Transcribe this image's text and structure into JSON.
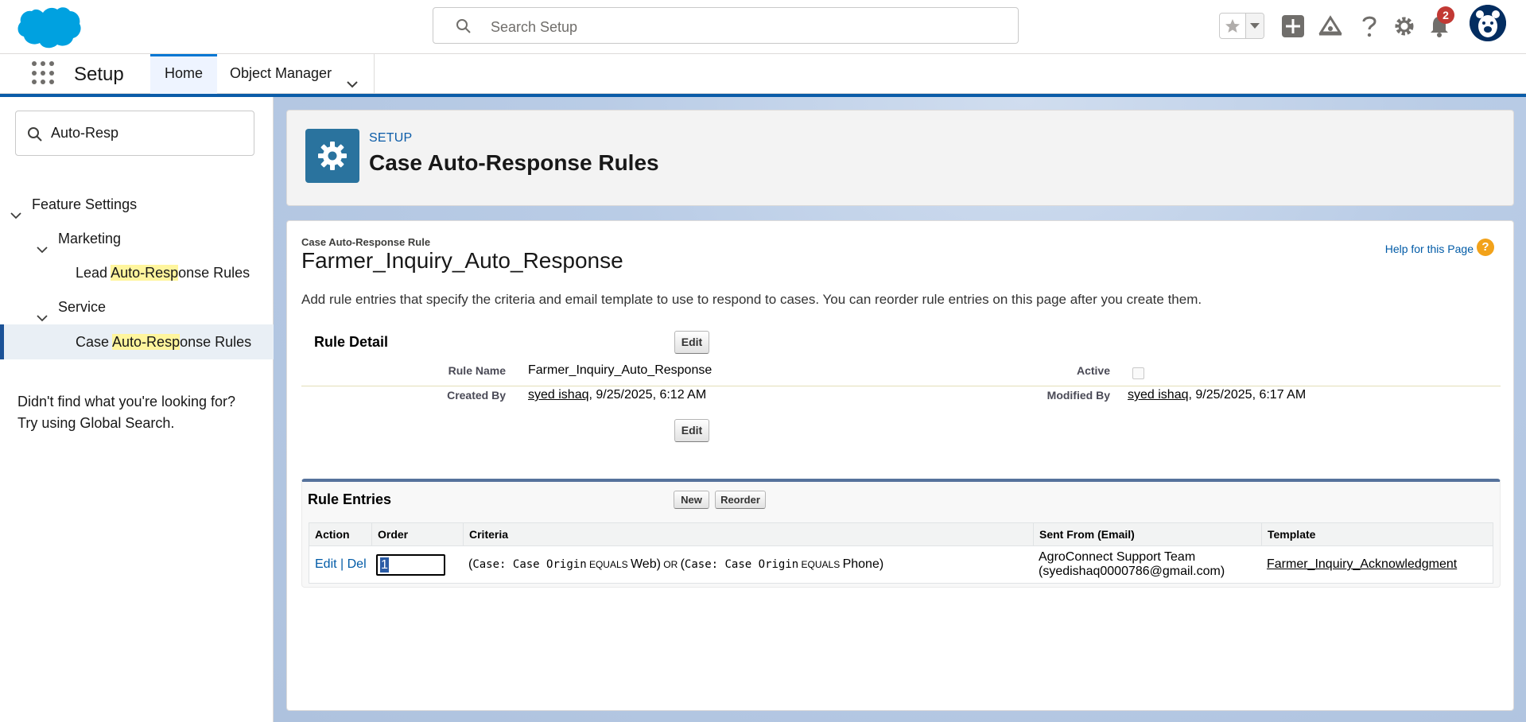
{
  "header": {
    "search_placeholder": "Search Setup",
    "notification_count": "2"
  },
  "nav": {
    "app_name": "Setup",
    "tabs": [
      {
        "label": "Home",
        "active": true
      },
      {
        "label": "Object Manager",
        "active": false
      }
    ]
  },
  "sidebar": {
    "quickfind_value": "Auto-Resp",
    "items": [
      {
        "label": "Feature Settings"
      },
      {
        "label": "Marketing"
      },
      {
        "pre": "Lead ",
        "highlight": "Auto-Resp",
        "post": "onse Rules"
      },
      {
        "label": "Service"
      },
      {
        "pre": "Case ",
        "highlight": "Auto-Resp",
        "post": "onse Rules",
        "selected": true
      }
    ],
    "not_found_line1": "Didn't find what you're looking for?",
    "not_found_line2": "Try using Global Search."
  },
  "page_header": {
    "kicker": "SETUP",
    "title": "Case Auto-Response Rules"
  },
  "rule": {
    "kicker": "Case Auto-Response Rule",
    "title": "Farmer_Inquiry_Auto_Response",
    "help_link": "Help for this Page",
    "description": "Add rule entries that specify the criteria and email template to use to respond to cases. You can reorder rule entries on this page after you create them.",
    "detail_title": "Rule Detail",
    "edit_label": "Edit",
    "fields": {
      "rule_name_label": "Rule Name",
      "rule_name_value": "Farmer_Inquiry_Auto_Response",
      "active_label": "Active",
      "active_value": false,
      "created_by_label": "Created By",
      "created_by_user": "syed ishaq",
      "created_by_date": ", 9/25/2025, 6:12 AM",
      "modified_by_label": "Modified By",
      "modified_by_user": "syed ishaq",
      "modified_by_date": ", 9/25/2025, 6:17 AM"
    }
  },
  "entries": {
    "title": "Rule Entries",
    "new_label": "New",
    "reorder_label": "Reorder",
    "columns": [
      "Action",
      "Order",
      "Criteria",
      "Sent From (Email)",
      "Template"
    ],
    "rows": [
      {
        "edit": "Edit",
        "sep": " | ",
        "del": "Del",
        "order": "1",
        "criteria": {
          "p1": "(",
          "f1": "Case: Case Origin",
          "op1": " EQUALS ",
          "v1": "Web",
          "p2": ")",
          "or": " OR ",
          "p3": "(",
          "f2": "Case: Case Origin",
          "op2": " EQUALS ",
          "v2": "Phone",
          "p4": ")"
        },
        "sent_from_line1": "AgroConnect Support Team",
        "sent_from_line2": "(syedishaq0000786@gmail.com)",
        "template": "Farmer_Inquiry_Acknowledgment"
      }
    ]
  },
  "colors": {
    "brand_blue": "#0b5ca8",
    "setup_icon_bg": "#2a739e",
    "link": "#015ba7",
    "badge_red": "#c23934"
  }
}
